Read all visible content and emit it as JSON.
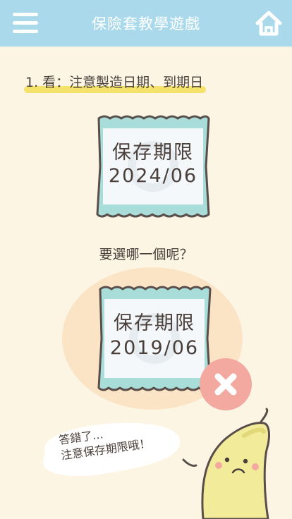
{
  "header": {
    "title": "保險套教學遊戲"
  },
  "step": {
    "text": "1. 看：注意製造日期、到期日"
  },
  "packets": [
    {
      "label": "保存期限",
      "date": "2024/06"
    },
    {
      "label": "保存期限",
      "date": "2019/06"
    }
  ],
  "question": "要選哪一個呢？",
  "feedback": {
    "line1": "答錯了...",
    "line2": "注意保存期限哦！"
  },
  "colors": {
    "header_bg": "#a9d9ea",
    "page_bg": "#fdf5e4",
    "packet_band": "#a9ddd9",
    "highlight": "#f5e26a",
    "wrong_badge": "#f3a8a0",
    "banana": "#f2ec9a"
  },
  "icons": {
    "menu": "hamburger-icon",
    "home": "home-icon",
    "wrong": "x-icon"
  }
}
